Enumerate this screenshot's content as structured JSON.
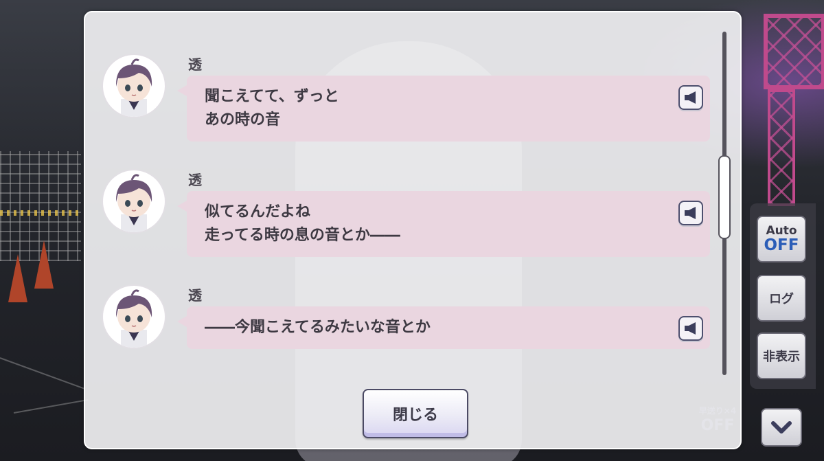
{
  "log": {
    "entries": [
      {
        "speaker": "透",
        "lines": [
          "聞こえてて、ずっと",
          "あの時の音"
        ]
      },
      {
        "speaker": "透",
        "lines": [
          "似てるんだよね",
          "走ってる時の息の音とか――"
        ]
      },
      {
        "speaker": "透",
        "lines": [
          "――今聞こえてるみたいな音とか"
        ]
      }
    ],
    "close_label": "閉じる",
    "voice_icon": "speaker-icon"
  },
  "controls": {
    "auto_label": "Auto",
    "auto_state": "OFF",
    "log_label": "ログ",
    "hide_label": "非表示",
    "fast_forward_label": "早送り×4",
    "fast_forward_state": "OFF",
    "down_icon": "chevron-down-icon"
  },
  "colors": {
    "bubble": "#ead6e0",
    "auto_off": "#2b5db7",
    "truss": "#c04a8c"
  }
}
